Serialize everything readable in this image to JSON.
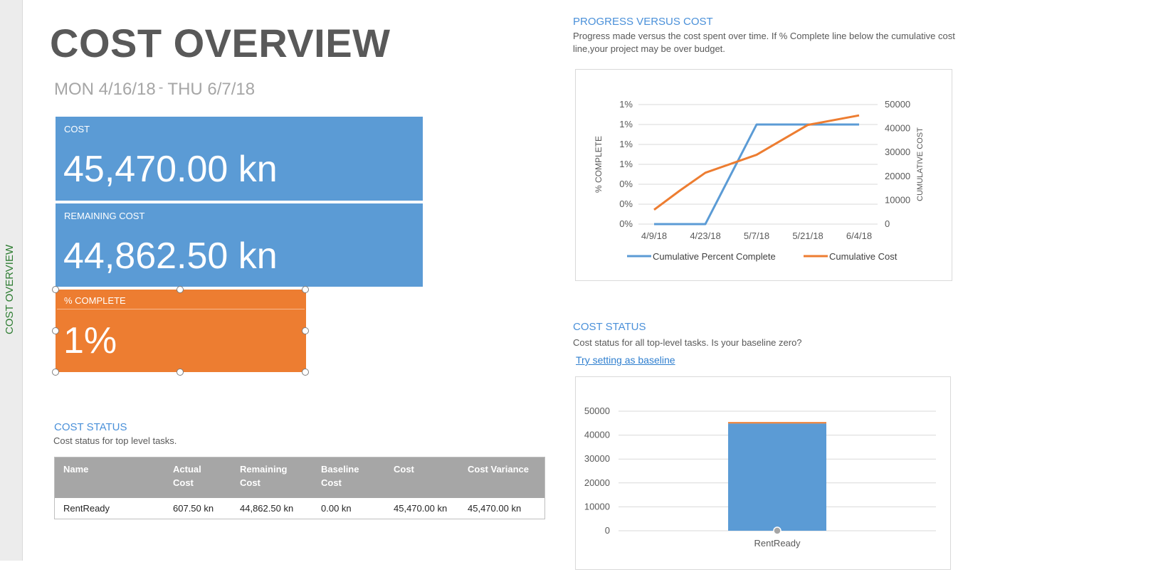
{
  "sidebar": {
    "label": "COST OVERVIEW"
  },
  "header": {
    "title": "COST OVERVIEW",
    "start_date": "MON 4/16/18",
    "separator": "-",
    "end_date": "THU 6/7/18"
  },
  "cards": {
    "cost": {
      "label": "COST",
      "value": "45,470.00 kn"
    },
    "remaining": {
      "label": "REMAINING COST",
      "value": "44,862.50 kn"
    },
    "complete": {
      "label": "% COMPLETE",
      "value": "1%"
    }
  },
  "cost_status_table": {
    "title": "COST STATUS",
    "description": "Cost status for top level tasks.",
    "headers": [
      "Name",
      "Actual Cost",
      "Remaining Cost",
      "Baseline Cost",
      "Cost",
      "Cost Variance"
    ],
    "rows": [
      [
        "RentReady",
        "607.50 kn",
        "44,862.50 kn",
        "0.00 kn",
        "45,470.00 kn",
        "45,470.00 kn"
      ]
    ]
  },
  "progress_section": {
    "title": "PROGRESS VERSUS COST",
    "description_line1": "Progress made versus the cost spent over time. If % Complete line below the cumulative cost",
    "description_line2": "line,your project may be over budget."
  },
  "cost_status_section": {
    "title": "COST STATUS",
    "description": "Cost status for all top-level tasks. Is your baseline zero?",
    "link": "Try setting as baseline"
  },
  "colors": {
    "blue": "#5b9bd5",
    "orange": "#ed7d31",
    "gray_header": "#a6a6a6",
    "title_blue": "#4a90d9"
  },
  "chart_data": [
    {
      "type": "line",
      "x": [
        "4/9/18",
        "4/16/18",
        "4/23/18",
        "5/7/18",
        "5/21/18",
        "6/4/18"
      ],
      "x_tick_labels": [
        "4/9/18",
        "4/23/18",
        "5/7/18",
        "5/21/18",
        "6/4/18"
      ],
      "y_tick_labels": [
        "0%",
        "0%",
        "0%",
        "1%",
        "1%",
        "1%",
        "1%"
      ],
      "y2_tick_labels": [
        "0",
        "10000",
        "20000",
        "30000",
        "40000",
        "50000"
      ],
      "ylabel": "% COMPLETE",
      "y2label": "CUMULATIVE COST",
      "ylim": [
        0,
        1.2
      ],
      "y2lim": [
        0,
        50000
      ],
      "legend_position": "bottom",
      "series": [
        {
          "name": "Cumulative Percent Complete",
          "axis": "left",
          "color": "#5b9bd5",
          "values": [
            0,
            0,
            0,
            1,
            1,
            1
          ]
        },
        {
          "name": "Cumulative Cost",
          "axis": "right",
          "color": "#ed7d31",
          "values": [
            6000,
            14000,
            21500,
            29000,
            41500,
            45470
          ]
        }
      ]
    },
    {
      "type": "bar",
      "stacked": true,
      "categories": [
        "RentReady"
      ],
      "ylim": [
        0,
        50000
      ],
      "y_tick_labels": [
        "0",
        "10000",
        "20000",
        "30000",
        "40000",
        "50000"
      ],
      "series": [
        {
          "color": "#5b9bd5",
          "values": [
            44862.5
          ]
        },
        {
          "color": "#ed7d31",
          "values": [
            607.5
          ]
        }
      ]
    }
  ]
}
